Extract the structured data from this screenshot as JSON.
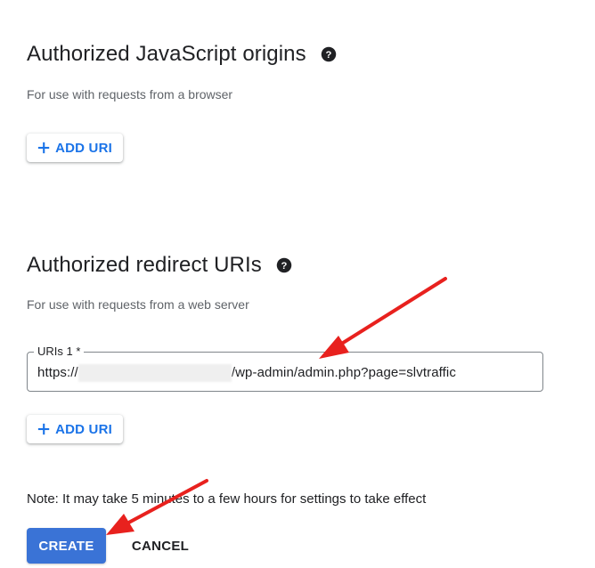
{
  "js_origins": {
    "title": "Authorized JavaScript origins",
    "help_icon": "help-circle-icon",
    "subtitle": "For use with requests from a browser",
    "add_uri_label": "ADD URI"
  },
  "redirect_uris": {
    "title": "Authorized redirect URIs",
    "help_icon": "help-circle-icon",
    "subtitle": "For use with requests from a web server",
    "uri_field": {
      "label": "URIs 1 *",
      "value_prefix": "https://",
      "value_suffix": "/wp-admin/admin.php?page=slvtraffic"
    },
    "add_uri_label": "ADD URI"
  },
  "note": {
    "text": "Note: It may take 5 minutes to a few hours for settings to take effect"
  },
  "actions": {
    "create_label": "CREATE",
    "cancel_label": "CANCEL"
  },
  "colors": {
    "primary": "#1a73e8",
    "create_button": "#3a73d6",
    "annotation_arrow": "#e8211e"
  },
  "icons": {
    "plus": "plus-icon",
    "annotation": "red-arrow-icon"
  }
}
